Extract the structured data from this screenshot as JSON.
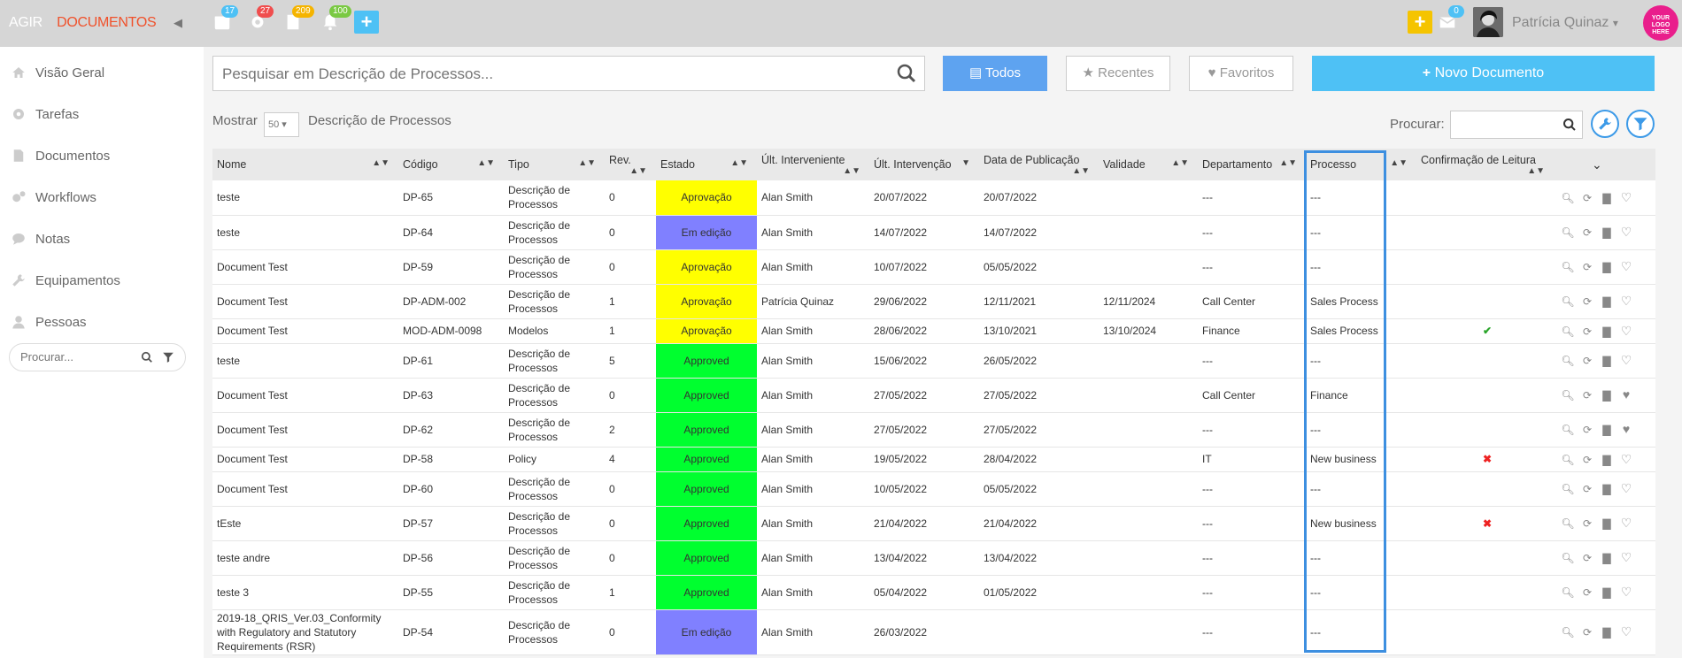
{
  "brand": {
    "agir": "AGIR",
    "docs": "DOCUMENTOS"
  },
  "top_badges": [
    {
      "icon": "calendar-icon",
      "count": "17",
      "color": "#4ec1f5"
    },
    {
      "icon": "gears-icon",
      "count": "27",
      "color": "#f04e4e"
    },
    {
      "icon": "document-icon",
      "count": "209",
      "color": "#f5b400"
    },
    {
      "icon": "bell-icon",
      "count": "100",
      "color": "#7ac943"
    }
  ],
  "messages_badge": "0",
  "user": {
    "name": "Patrícia Quinaz"
  },
  "logo_text": "YOUR LOGO HERE",
  "sidebar": {
    "items": [
      {
        "label": "Visão Geral",
        "icon": "home-icon"
      },
      {
        "label": "Tarefas",
        "icon": "gear-icon"
      },
      {
        "label": "Documentos",
        "icon": "file-icon"
      },
      {
        "label": "Workflows",
        "icon": "gears-icon"
      },
      {
        "label": "Notas",
        "icon": "chat-icon"
      },
      {
        "label": "Equipamentos",
        "icon": "wrench-icon"
      },
      {
        "label": "Pessoas",
        "icon": "user-icon"
      }
    ],
    "search_placeholder": "Procurar..."
  },
  "search": {
    "placeholder": "Pesquisar em Descrição de Processos..."
  },
  "filters": {
    "todos": "Todos",
    "recentes": "Recentes",
    "favoritos": "Favoritos",
    "novo": "Novo Documento"
  },
  "toolbar": {
    "mostrar": "Mostrar",
    "page_size": "50",
    "context": "Descrição de Processos",
    "procurar": "Procurar:"
  },
  "table": {
    "columns": [
      "Nome",
      "Código",
      "Tipo",
      "Rev.",
      "Estado",
      "Últ. Interveniente",
      "Últ. Intervenção",
      "Data de Publicação",
      "Validade",
      "Departamento",
      "Processo",
      "Confirmação de Leitura"
    ],
    "rows": [
      {
        "nome": "teste",
        "codigo": "DP-65",
        "tipo": "Descrição de Processos",
        "rev": "0",
        "estado": "Aprovação",
        "interv": "Alan Smith",
        "ult": "20/07/2022",
        "pub": "20/07/2022",
        "val": "",
        "dep": "---",
        "proc": "---",
        "conf": "",
        "fav": "heart-outline-icon"
      },
      {
        "nome": "teste",
        "codigo": "DP-64",
        "tipo": "Descrição de Processos",
        "rev": "0",
        "estado": "Em edição",
        "interv": "Alan Smith",
        "ult": "14/07/2022",
        "pub": "14/07/2022",
        "val": "",
        "dep": "---",
        "proc": "---",
        "conf": "",
        "fav": "heart-outline-icon"
      },
      {
        "nome": "Document Test",
        "codigo": "DP-59",
        "tipo": "Descrição de Processos",
        "rev": "0",
        "estado": "Aprovação",
        "interv": "Alan Smith",
        "ult": "10/07/2022",
        "pub": "05/05/2022",
        "val": "",
        "dep": "---",
        "proc": "---",
        "conf": "",
        "fav": "heart-outline-icon"
      },
      {
        "nome": "Document Test",
        "codigo": "DP-ADM-002",
        "tipo": "Descrição de Processos",
        "rev": "1",
        "estado": "Aprovação",
        "interv": "Patrícia Quinaz",
        "ult": "29/06/2022",
        "pub": "12/11/2021",
        "val": "12/11/2024",
        "dep": "Call Center",
        "proc": "Sales Process",
        "conf": "",
        "fav": "heart-outline-icon"
      },
      {
        "nome": "Document Test",
        "codigo": "MOD-ADM-0098",
        "tipo": "Modelos",
        "rev": "1",
        "estado": "Aprovação",
        "interv": "Alan Smith",
        "ult": "28/06/2022",
        "pub": "13/10/2021",
        "val": "13/10/2024",
        "dep": "Finance",
        "proc": "Sales Process",
        "conf": "check",
        "fav": "heart-outline-icon"
      },
      {
        "nome": "teste",
        "codigo": "DP-61",
        "tipo": "Descrição de Processos",
        "rev": "5",
        "estado": "Approved",
        "interv": "Alan Smith",
        "ult": "15/06/2022",
        "pub": "26/05/2022",
        "val": "",
        "dep": "---",
        "proc": "---",
        "conf": "",
        "fav": "heart-outline-icon"
      },
      {
        "nome": "Document Test",
        "codigo": "DP-63",
        "tipo": "Descrição de Processos",
        "rev": "0",
        "estado": "Approved",
        "interv": "Alan Smith",
        "ult": "27/05/2022",
        "pub": "27/05/2022",
        "val": "",
        "dep": "Call Center",
        "proc": "Finance",
        "conf": "",
        "fav": "heart-filled-icon"
      },
      {
        "nome": "Document Test",
        "codigo": "DP-62",
        "tipo": "Descrição de Processos",
        "rev": "2",
        "estado": "Approved",
        "interv": "Alan Smith",
        "ult": "27/05/2022",
        "pub": "27/05/2022",
        "val": "",
        "dep": "---",
        "proc": "---",
        "conf": "",
        "fav": "heart-filled-icon"
      },
      {
        "nome": "Document Test",
        "codigo": "DP-58",
        "tipo": "Policy",
        "rev": "4",
        "estado": "Approved",
        "interv": "Alan Smith",
        "ult": "19/05/2022",
        "pub": "28/04/2022",
        "val": "",
        "dep": "IT",
        "proc": "New business",
        "conf": "cross",
        "fav": "heart-outline-icon"
      },
      {
        "nome": "Document Test",
        "codigo": "DP-60",
        "tipo": "Descrição de Processos",
        "rev": "0",
        "estado": "Approved",
        "interv": "Alan Smith",
        "ult": "10/05/2022",
        "pub": "05/05/2022",
        "val": "",
        "dep": "---",
        "proc": "---",
        "conf": "",
        "fav": "heart-outline-icon"
      },
      {
        "nome": "tEste",
        "codigo": "DP-57",
        "tipo": "Descrição de Processos",
        "rev": "0",
        "estado": "Approved",
        "interv": "Alan Smith",
        "ult": "21/04/2022",
        "pub": "21/04/2022",
        "val": "",
        "dep": "---",
        "proc": "New business",
        "conf": "cross",
        "fav": "heart-outline-icon"
      },
      {
        "nome": "teste andre",
        "codigo": "DP-56",
        "tipo": "Descrição de Processos",
        "rev": "0",
        "estado": "Approved",
        "interv": "Alan Smith",
        "ult": "13/04/2022",
        "pub": "13/04/2022",
        "val": "",
        "dep": "---",
        "proc": "---",
        "conf": "",
        "fav": "heart-outline-icon"
      },
      {
        "nome": "teste 3",
        "codigo": "DP-55",
        "tipo": "Descrição de Processos",
        "rev": "1",
        "estado": "Approved",
        "interv": "Alan Smith",
        "ult": "05/04/2022",
        "pub": "01/05/2022",
        "val": "",
        "dep": "---",
        "proc": "---",
        "conf": "",
        "fav": "heart-outline-icon"
      },
      {
        "nome": "2019-18_QRIS_Ver.03_Conformity with Regulatory and Statutory Requirements (RSR)",
        "codigo": "DP-54",
        "tipo": "Descrição de Processos",
        "rev": "0",
        "estado": "Em edição",
        "interv": "Alan Smith",
        "ult": "26/03/2022",
        "pub": "",
        "val": "",
        "dep": "---",
        "proc": "---",
        "conf": "",
        "fav": "heart-outline-icon"
      }
    ]
  },
  "status_colors": {
    "Aprovação": "#ffff00",
    "Em edição": "#8080ff",
    "Approved": "#00ff2f"
  },
  "highlight_color": "#3d8fe0"
}
